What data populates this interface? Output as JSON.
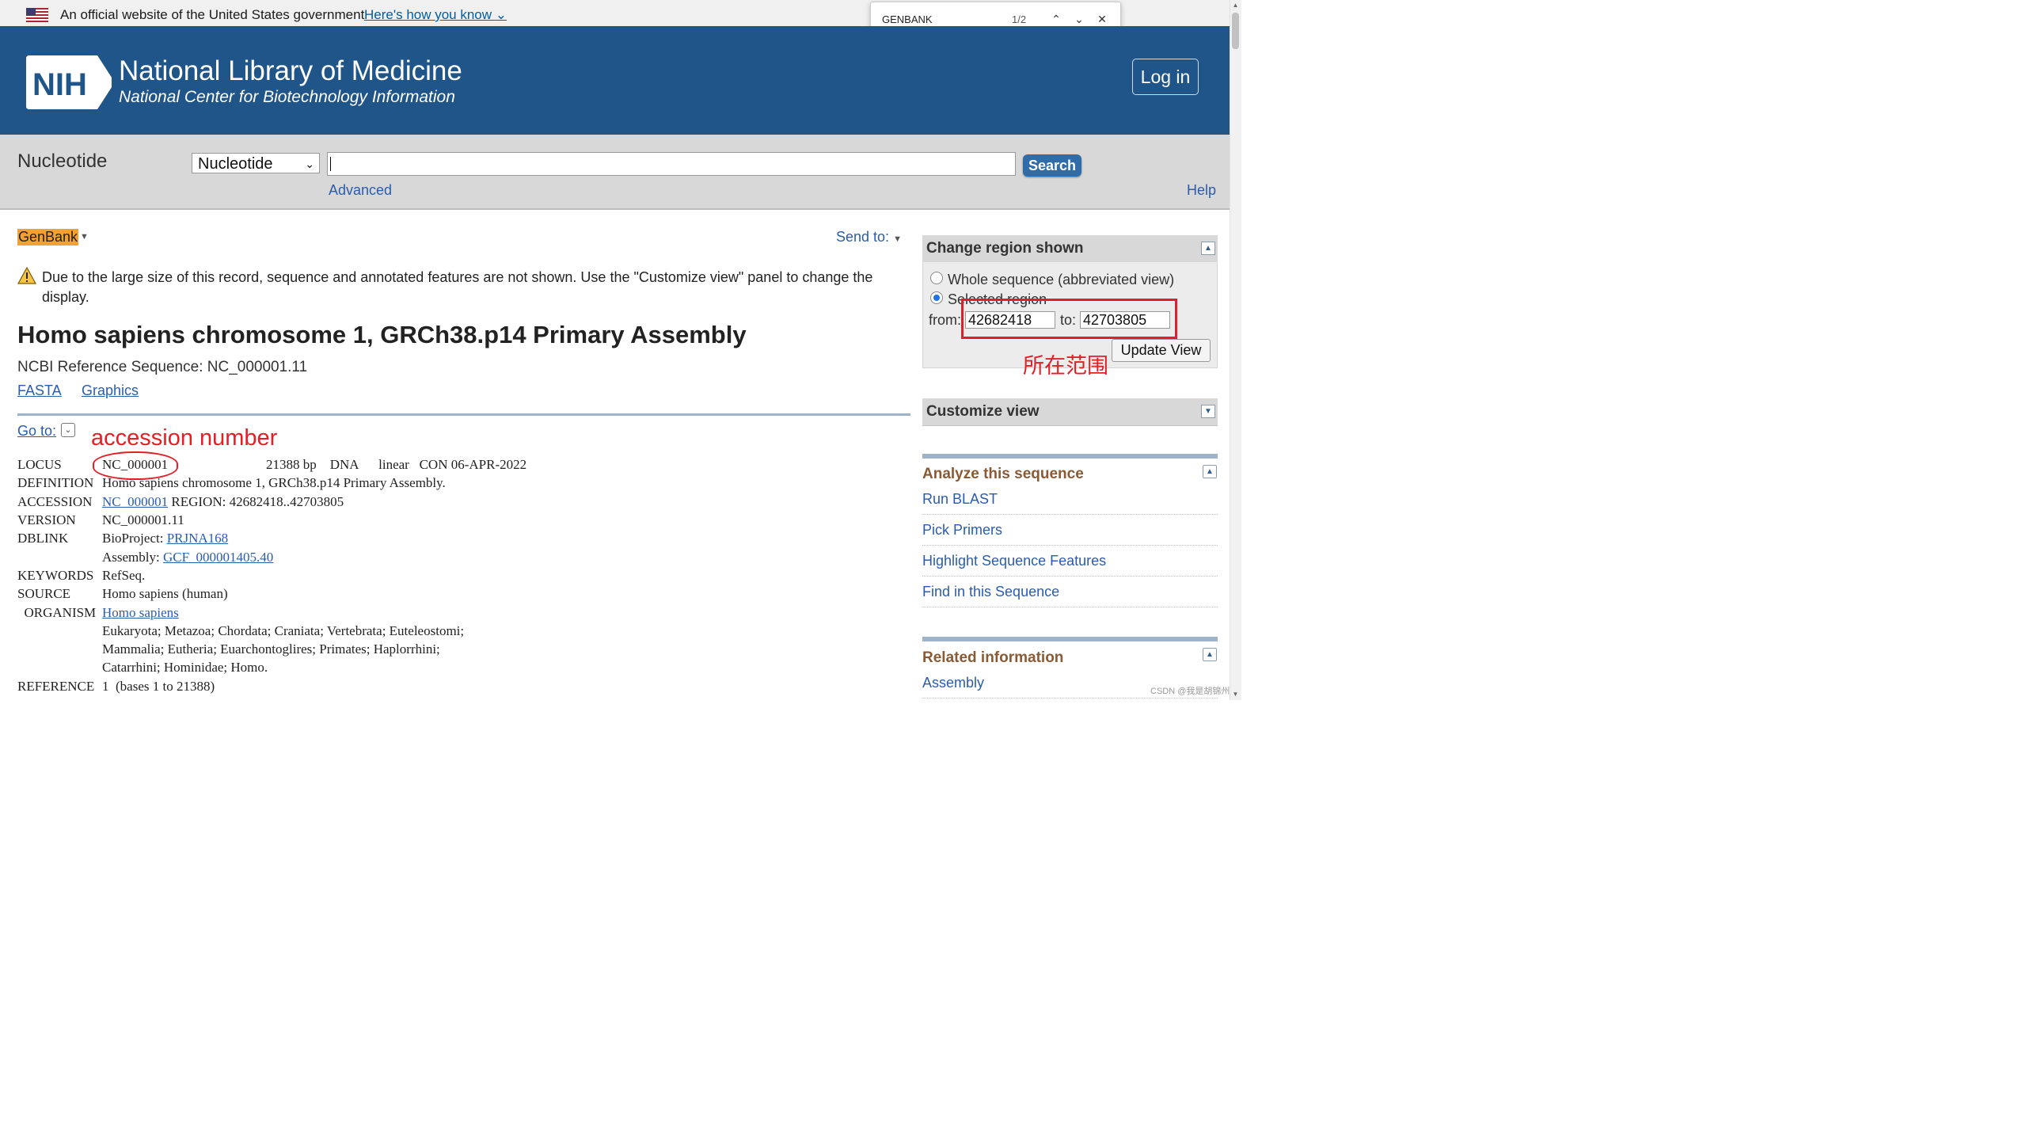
{
  "gov_banner": {
    "text": "An official website of the United States government",
    "link": "Here's how you know"
  },
  "find_bar": {
    "query": "GENBANK",
    "count": "1/2"
  },
  "header": {
    "logo_text": "NIH",
    "title": "National Library of Medicine",
    "subtitle": "National Center for Biotechnology Information",
    "login": "Log in"
  },
  "search": {
    "db_title": "Nucleotide",
    "db_selected": "Nucleotide",
    "query": "",
    "button": "Search",
    "advanced": "Advanced",
    "help": "Help"
  },
  "record": {
    "format": "GenBank",
    "send_to": "Send to:",
    "warning": "Due to the large size of this record, sequence and annotated features are not shown. Use the \"Customize view\" panel to change the display.",
    "title": "Homo sapiens chromosome 1, GRCh38.p14 Primary Assembly",
    "refseq": "NCBI Reference Sequence: NC_000001.11",
    "fasta_link": "FASTA",
    "graphics_link": "Graphics",
    "goto": "Go to:",
    "annotation_accession": "accession number"
  },
  "genbank": {
    "locus_key": "LOCUS",
    "locus_id": "NC_000001",
    "locus_rest": "21388 bp    DNA      linear   CON 06-APR-2022",
    "definition_key": "DEFINITION",
    "definition": "Homo sapiens chromosome 1, GRCh38.p14 Primary Assembly.",
    "accession_key": "ACCESSION",
    "accession_link": "NC_000001",
    "accession_rest": " REGION: 42682418..42703805",
    "version_key": "VERSION",
    "version": "NC_000001.11",
    "dblink_key": "DBLINK",
    "bioproject_label": "BioProject: ",
    "bioproject_link": "PRJNA168",
    "assembly_label": "Assembly: ",
    "assembly_link": "GCF_000001405.40",
    "keywords_key": "KEYWORDS",
    "keywords": "RefSeq.",
    "source_key": "SOURCE",
    "source": "Homo sapiens (human)",
    "organism_key": "  ORGANISM",
    "organism_link": "Homo sapiens",
    "taxonomy_1": "Eukaryota; Metazoa; Chordata; Craniata; Vertebrata; Euteleostomi;",
    "taxonomy_2": "Mammalia; Eutheria; Euarchontoglires; Primates; Haplorrhini;",
    "taxonomy_3": "Catarrhini; Hominidae; Homo.",
    "reference_key": "REFERENCE",
    "reference": "1  (bases 1 to 21388)"
  },
  "sidebar": {
    "region": {
      "title": "Change region shown",
      "whole_label": "Whole sequence (abbreviated view)",
      "selected_label": "Selected region",
      "from_label": "from:",
      "from_value": "42682418",
      "to_label": "to:",
      "to_value": "42703805",
      "update_button": "Update View",
      "annotation": "所在范围"
    },
    "customize_title": "Customize view",
    "analyze": {
      "title": "Analyze this sequence",
      "items": [
        "Run BLAST",
        "Pick Primers",
        "Highlight Sequence Features",
        "Find in this Sequence"
      ]
    },
    "related": {
      "title": "Related information",
      "items": [
        "Assembly"
      ]
    }
  },
  "watermark": "CSDN @我是胡锦州",
  "colors": {
    "header_bg": "#20558a",
    "link": "#2b5cad",
    "genbank_highlight": "#f5a032",
    "annotation_red": "#e21f26",
    "section_title": "#8a5a34"
  }
}
